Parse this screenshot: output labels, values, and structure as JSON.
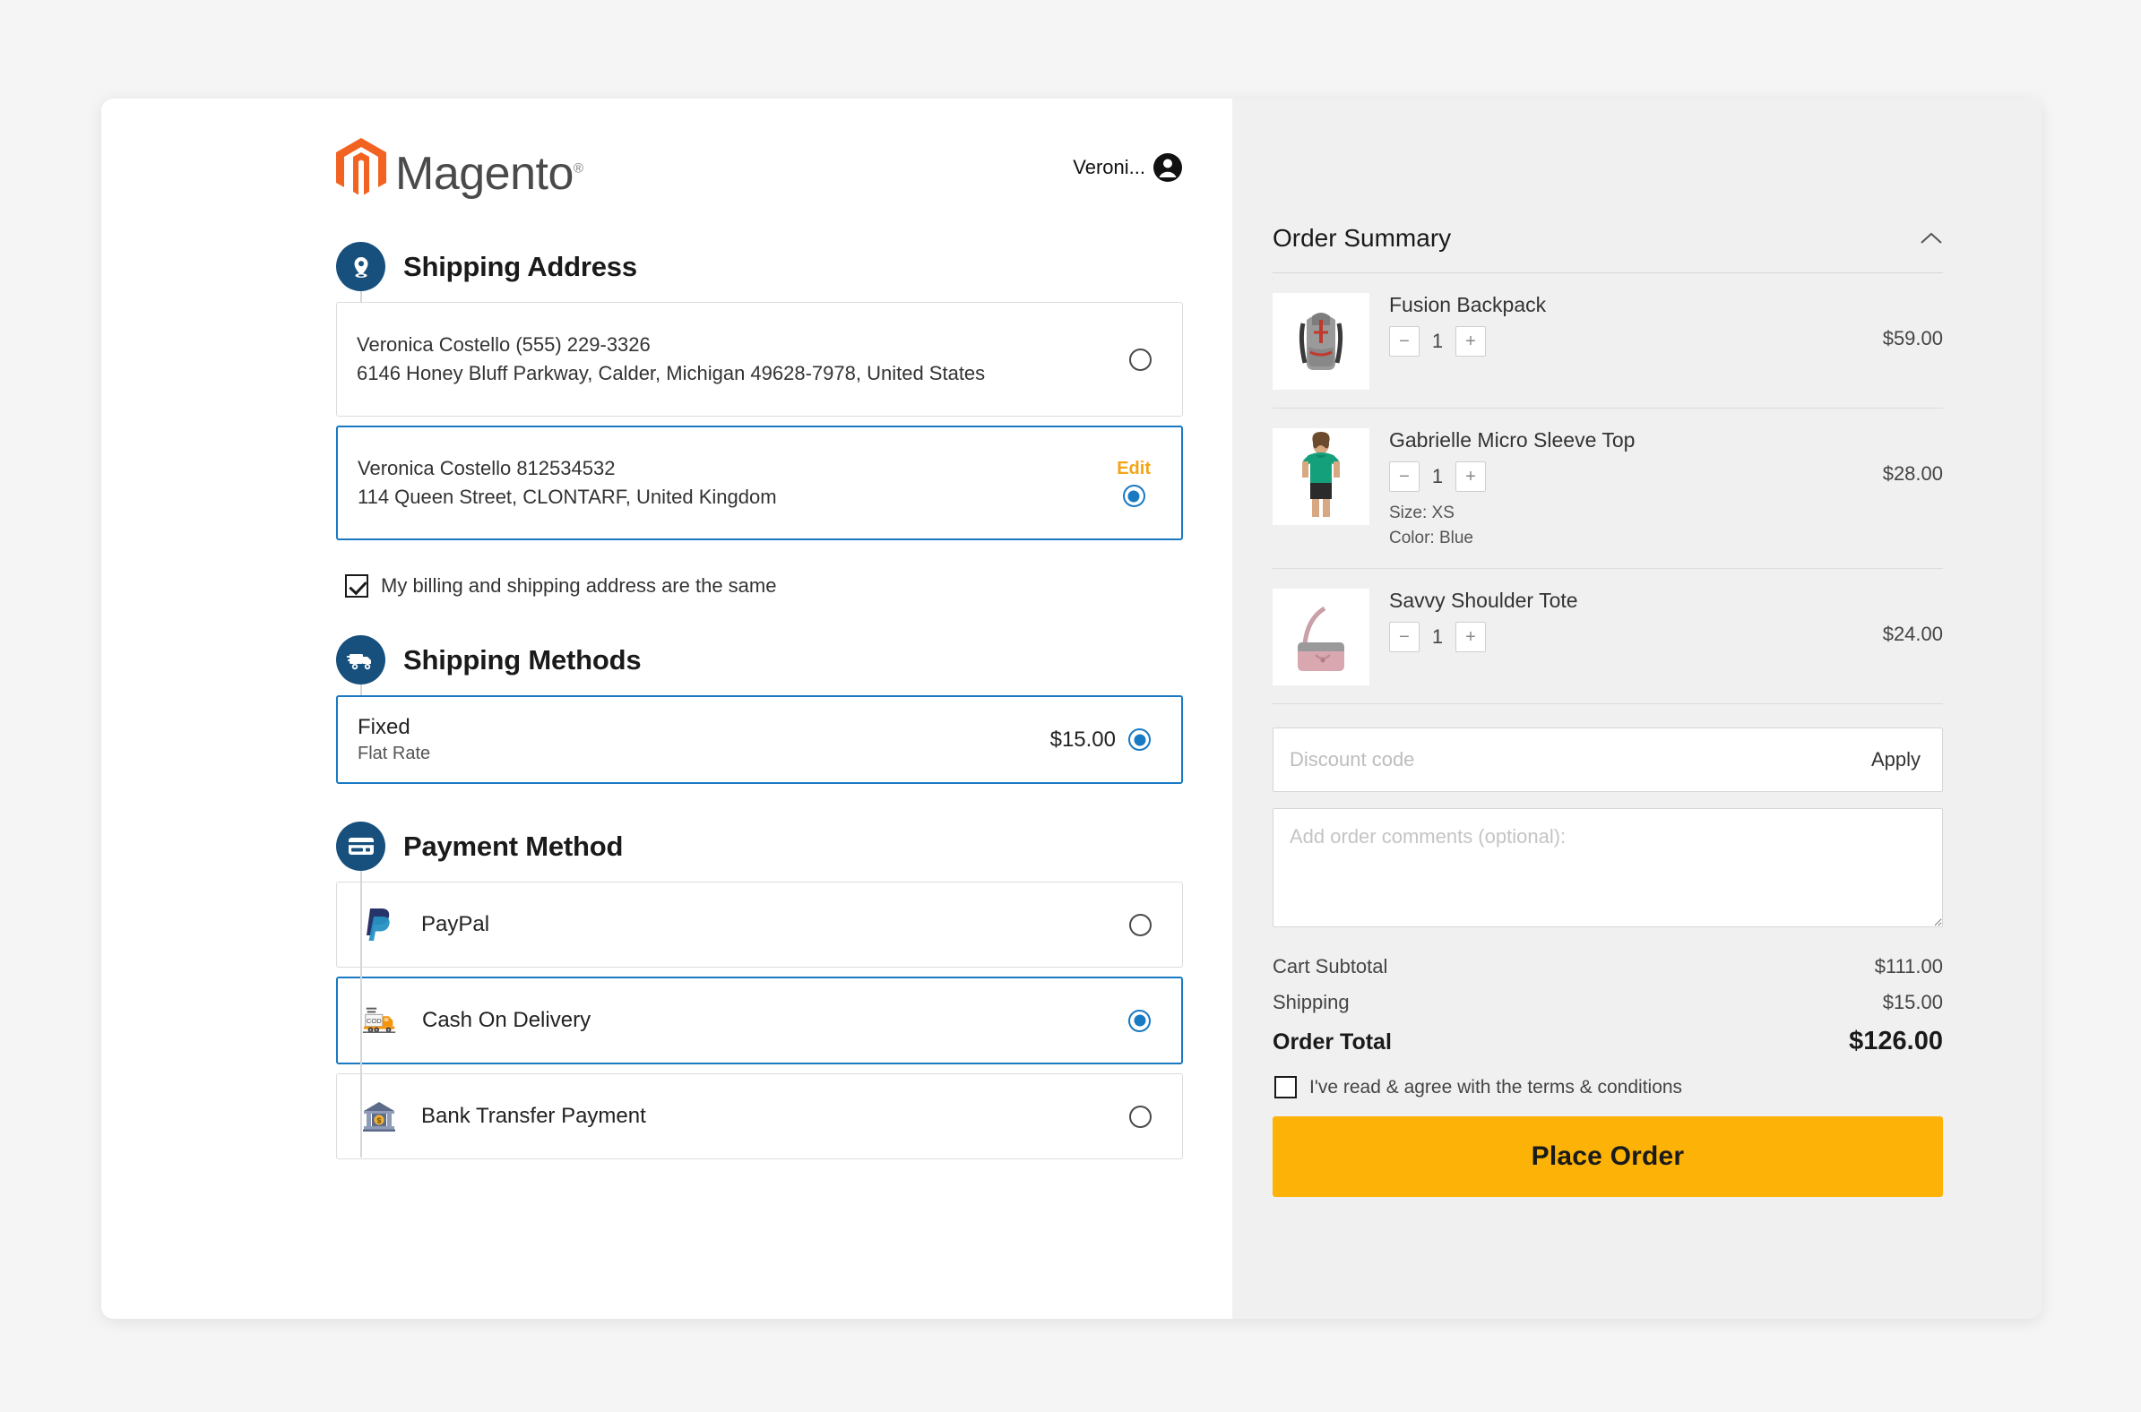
{
  "header": {
    "logo_text": "Magento",
    "logo_reg": "®",
    "user_name": "Veroni...",
    "avatar_icon": "user-avatar-icon"
  },
  "shipping_address": {
    "step_title": "Shipping Address",
    "step_icon": "location-pin-icon",
    "addresses": [
      {
        "line1": "Veronica Costello (555) 229-3326",
        "line2": "6146 Honey Bluff Parkway, Calder, Michigan 49628-7978, United States",
        "selected": false,
        "edit_label": ""
      },
      {
        "line1": "Veronica Costello 812534532",
        "line2": "114 Queen Street, CLONTARF, United Kingdom",
        "selected": true,
        "edit_label": "Edit"
      }
    ],
    "billing_same_label": "My billing and shipping address are the same",
    "billing_same_checked": true
  },
  "shipping_methods": {
    "step_title": "Shipping Methods",
    "step_icon": "delivery-truck-icon",
    "methods": [
      {
        "title": "Fixed",
        "subtitle": "Flat Rate",
        "price": "$15.00",
        "selected": true
      }
    ]
  },
  "payment_method": {
    "step_title": "Payment Method",
    "step_icon": "credit-card-icon",
    "methods": [
      {
        "label": "PayPal",
        "icon": "paypal-icon",
        "selected": false
      },
      {
        "label": "Cash On Delivery",
        "icon": "cod-truck-icon",
        "selected": true
      },
      {
        "label": "Bank Transfer Payment",
        "icon": "bank-icon",
        "selected": false
      }
    ]
  },
  "order_summary": {
    "title": "Order Summary",
    "collapse_icon": "chevron-up-icon",
    "items": [
      {
        "name": "Fusion Backpack",
        "qty": "1",
        "price": "$59.00",
        "thumb": "backpack-thumbnail",
        "options": []
      },
      {
        "name": "Gabrielle Micro Sleeve Top",
        "qty": "1",
        "price": "$28.00",
        "thumb": "top-thumbnail",
        "options": [
          "Size: XS",
          "Color: Blue"
        ]
      },
      {
        "name": "Savvy Shoulder Tote",
        "qty": "1",
        "price": "$24.00",
        "thumb": "tote-thumbnail",
        "options": []
      }
    ],
    "discount": {
      "value": "",
      "placeholder": "Discount code",
      "apply_label": "Apply"
    },
    "comments": {
      "value": "",
      "placeholder": "Add order comments (optional):"
    },
    "totals": [
      {
        "label": "Cart Subtotal",
        "value": "$111.00"
      },
      {
        "label": "Shipping",
        "value": "$15.00"
      }
    ],
    "grand_total": {
      "label": "Order Total",
      "value": "$126.00"
    },
    "terms_label": "I've read & agree with the terms & conditions",
    "terms_checked": false,
    "place_order_label": "Place Order"
  },
  "qty_controls": {
    "minus": "−",
    "plus": "+"
  },
  "colors": {
    "step_badge": "#17507d",
    "selected_blue": "#1979c3",
    "edit_amber": "#f2a516",
    "place_order": "#fcb206",
    "magento_orange": "#f26322",
    "summary_bg": "#f0f0f0",
    "page_bg": "#f5f5f5"
  }
}
